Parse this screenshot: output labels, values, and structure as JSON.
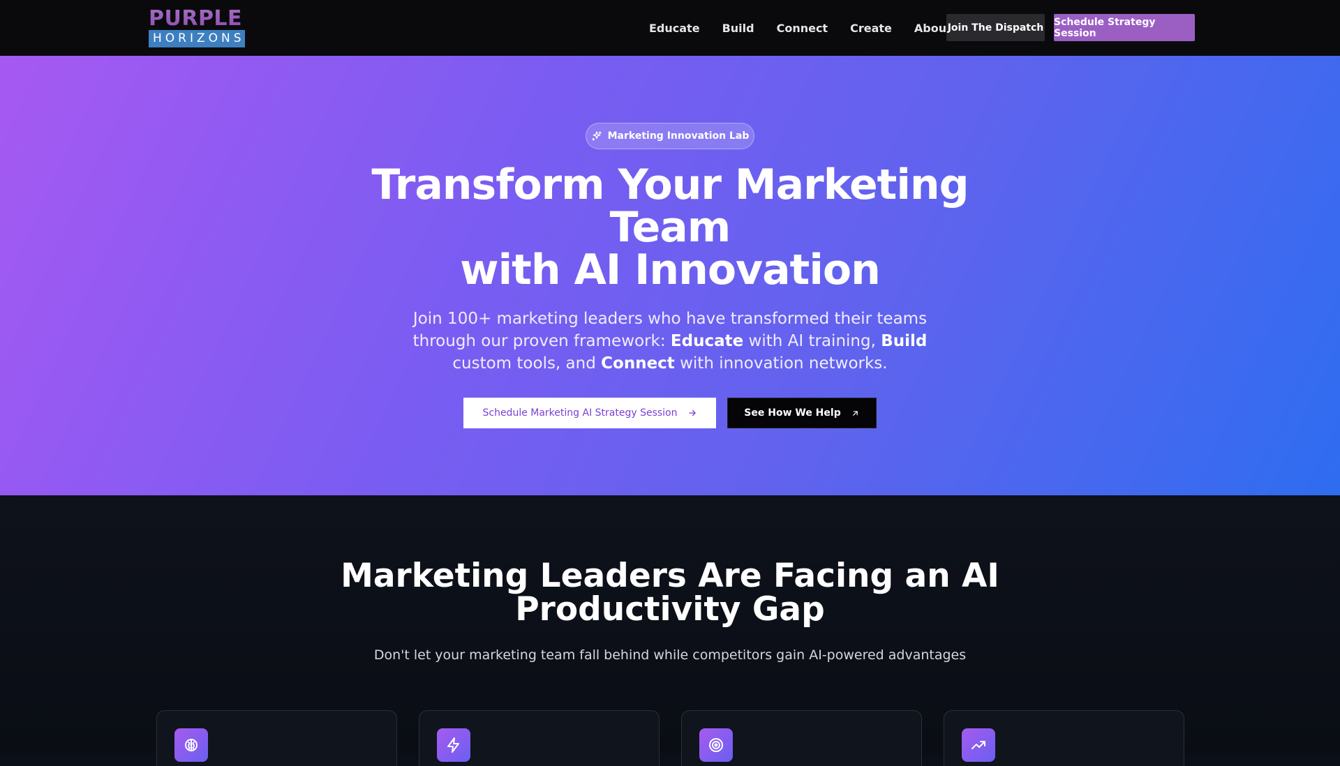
{
  "nav": {
    "logo_top": "PURPLE",
    "logo_bottom": "HORIZONS",
    "links": [
      "Educate",
      "Build",
      "Connect",
      "Create",
      "About"
    ],
    "dispatch_label": "Join The Dispatch",
    "schedule_label": "Schedule Strategy Session"
  },
  "hero": {
    "pill_label": "Marketing Innovation Lab",
    "title_line1": "Transform Your Marketing",
    "title_line2": "Team",
    "title_line3": "with AI Innovation",
    "sub_1": "Join 100+ marketing leaders who have transformed their teams through our proven framework: ",
    "sub_educate": "Educate",
    "sub_2": " with AI training, ",
    "sub_build": "Build",
    "sub_3": " custom tools, and ",
    "sub_connect": "Connect",
    "sub_4": " with innovation networks.",
    "cta_primary": "Schedule Marketing AI Strategy Session",
    "cta_secondary": "See How We Help"
  },
  "gap": {
    "title_line1": "Marketing Leaders Are Facing an AI",
    "title_line2": "Productivity Gap",
    "subtitle": "Don't let your marketing team fall behind while competitors gain AI-powered advantages",
    "cards": [
      {
        "icon": "brain-icon"
      },
      {
        "icon": "lightning-icon"
      },
      {
        "icon": "target-icon"
      },
      {
        "icon": "trending-up-icon"
      }
    ]
  },
  "colors": {
    "accent": "#9b5fc4",
    "hero_gradient_start": "#a659f2",
    "hero_gradient_end": "#2e6df0",
    "logo_blue": "#3d7fc1"
  }
}
